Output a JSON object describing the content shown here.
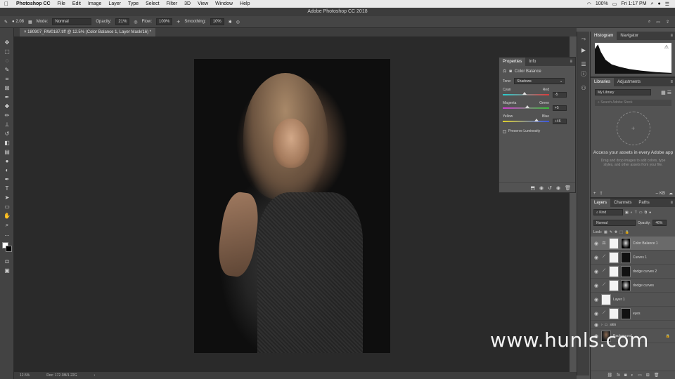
{
  "mac_menu": {
    "apple": "",
    "app": "Photoshop CC",
    "items": [
      "File",
      "Edit",
      "Image",
      "Layer",
      "Type",
      "Select",
      "Filter",
      "3D",
      "View",
      "Window",
      "Help"
    ],
    "battery": "100%",
    "clock": "Fri 1:17 PM"
  },
  "window_title": "Adobe Photoshop CC 2018",
  "options": {
    "brush_size": "2.08",
    "mode_label": "Mode:",
    "mode_value": "Normal",
    "opacity_label": "Opacity:",
    "opacity_value": "21%",
    "flow_label": "Flow:",
    "flow_value": "100%",
    "smoothing_label": "Smoothing:",
    "smoothing_value": "10%"
  },
  "doc_tab": "180907_RW0187.tiff @ 12.5% (Color Balance 1, Layer Mask/16) *",
  "status": {
    "zoom": "12.5%",
    "doc_size": "Doc: 172.3M/1.22G"
  },
  "properties": {
    "tabs": [
      "Properties",
      "Info"
    ],
    "title": "Color Balance",
    "tone_label": "Tone:",
    "tone_value": "Shadows",
    "sliders": [
      {
        "left": "Cyan",
        "right": "Red",
        "value": "-5",
        "fraction": 0.47,
        "gradient": [
          "#27d0d0",
          "#e03a3a"
        ]
      },
      {
        "left": "Magenta",
        "right": "Green",
        "value": "+5",
        "fraction": 0.53,
        "gradient": [
          "#d23ad2",
          "#36c236"
        ]
      },
      {
        "left": "Yellow",
        "right": "Blue",
        "value": "+46",
        "fraction": 0.73,
        "gradient": [
          "#e0d12a",
          "#3a56e0"
        ]
      }
    ],
    "preserve_label": "Preserve Luminosity"
  },
  "histogram_panel": {
    "tabs": [
      "Histogram",
      "Navigator"
    ]
  },
  "libraries_panel": {
    "tabs": [
      "Libraries",
      "Adjustments"
    ],
    "library_select": "My Library",
    "search_placeholder": "Search Adobe Stock",
    "message_title": "Access your assets in every Adobe app",
    "message_sub": "Drag and drop images to add colors, type styles, and other assets from your file.",
    "size_readout": "-- KB"
  },
  "layers_panel": {
    "tabs": [
      "Layers",
      "Channels",
      "Paths"
    ],
    "kind_label": "Kind",
    "blend_mode": "Normal",
    "opacity_label": "Opacity:",
    "opacity_value": "46%",
    "lock_label": "Lock:",
    "layers": [
      {
        "name": "Color Balance 1",
        "selected": true,
        "type": "adjustment",
        "thumb": "white",
        "mask": "mask"
      },
      {
        "name": "Curves 1",
        "selected": false,
        "type": "adjustment",
        "thumb": "white",
        "mask": "dark"
      },
      {
        "name": "dodge curves 2",
        "selected": false,
        "type": "adjustment",
        "thumb": "white",
        "mask": "dark"
      },
      {
        "name": "dodge curves",
        "selected": false,
        "type": "adjustment",
        "thumb": "white",
        "mask": "mask"
      },
      {
        "name": "Layer 1",
        "selected": false,
        "type": "pixel",
        "thumb": "white",
        "mask": ""
      },
      {
        "name": "eyes",
        "selected": false,
        "type": "adjustment",
        "thumb": "white",
        "mask": "dark"
      },
      {
        "name": "skin",
        "selected": false,
        "type": "group",
        "thumb": "",
        "mask": ""
      },
      {
        "name": "Background",
        "selected": false,
        "type": "pixel",
        "thumb": "photo",
        "mask": ""
      }
    ]
  },
  "watermark": "www.hunls.com"
}
